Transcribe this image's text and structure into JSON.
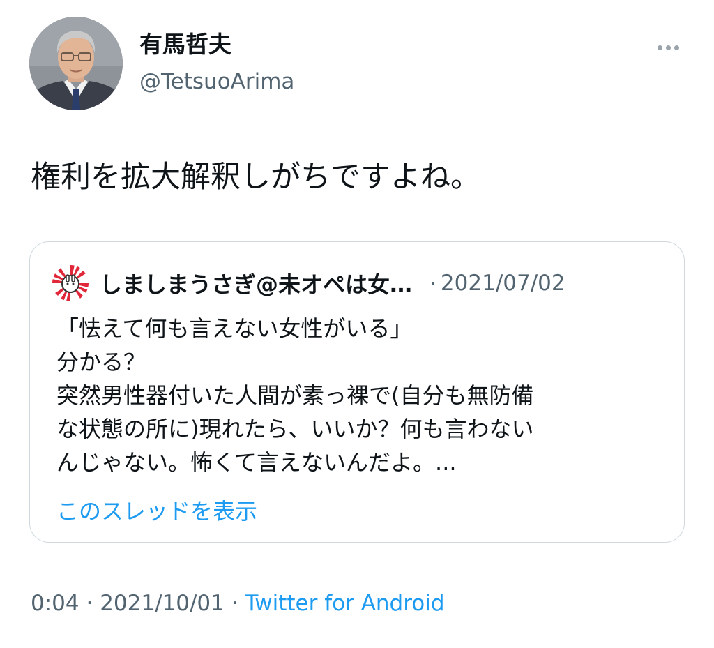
{
  "author": {
    "display_name": "有馬哲夫",
    "handle": "@TetsuoArima"
  },
  "menu": {
    "icon": "more-horizontal-icon"
  },
  "tweet": {
    "text": "権利を拡大解釈しがちですよね。"
  },
  "quote": {
    "author_name": "しましまうさぎ@未オペは女…",
    "separator": "·",
    "date": "2021/07/02",
    "lines": [
      "「怯えて何も言えない女性がいる」",
      "分かる？",
      "突然男性器付いた人間が素っ裸で(自分も無防備",
      "な状態の所に)現れたら、いいか？何も言わない",
      "んじゃない。怖くて言えないんだよ。..."
    ],
    "show_thread_label": "このスレッドを表示"
  },
  "meta": {
    "time": "0:04",
    "separator": "·",
    "date": "2021/10/01",
    "separator2": "·",
    "source": "Twitter for Android"
  },
  "colors": {
    "accent": "#1d9bf0",
    "secondary_text": "#536471",
    "border": "#cfd9de"
  }
}
